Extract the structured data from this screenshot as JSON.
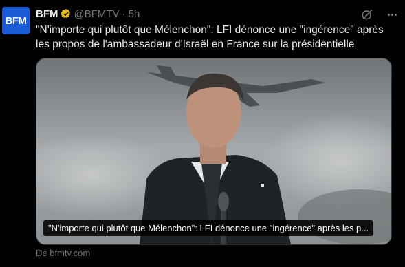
{
  "account": {
    "avatar_text": "BFM",
    "name": "BFM",
    "handle": "@BFMTV",
    "separator": "·",
    "time": "5h"
  },
  "tweet": {
    "text": "\"N'importe qui plutôt que Mélenchon\": LFI dénonce une \"ingérence\" après les propos de l'ambassadeur d'Israël en France sur la présidentielle"
  },
  "card": {
    "caption": "\"N'importe qui plutôt que Mélenchon\": LFI dénonce une \"ingérence\" après les p...",
    "source": "De bfmtv.com"
  },
  "icons": {
    "verified": "verified-badge-icon",
    "grok": "grok-icon",
    "more": "more-icon"
  },
  "colors": {
    "background": "#000000",
    "text": "#e7e9ea",
    "muted": "#71767b",
    "avatar": "#1a5bd6",
    "verified": "#e2b719"
  }
}
